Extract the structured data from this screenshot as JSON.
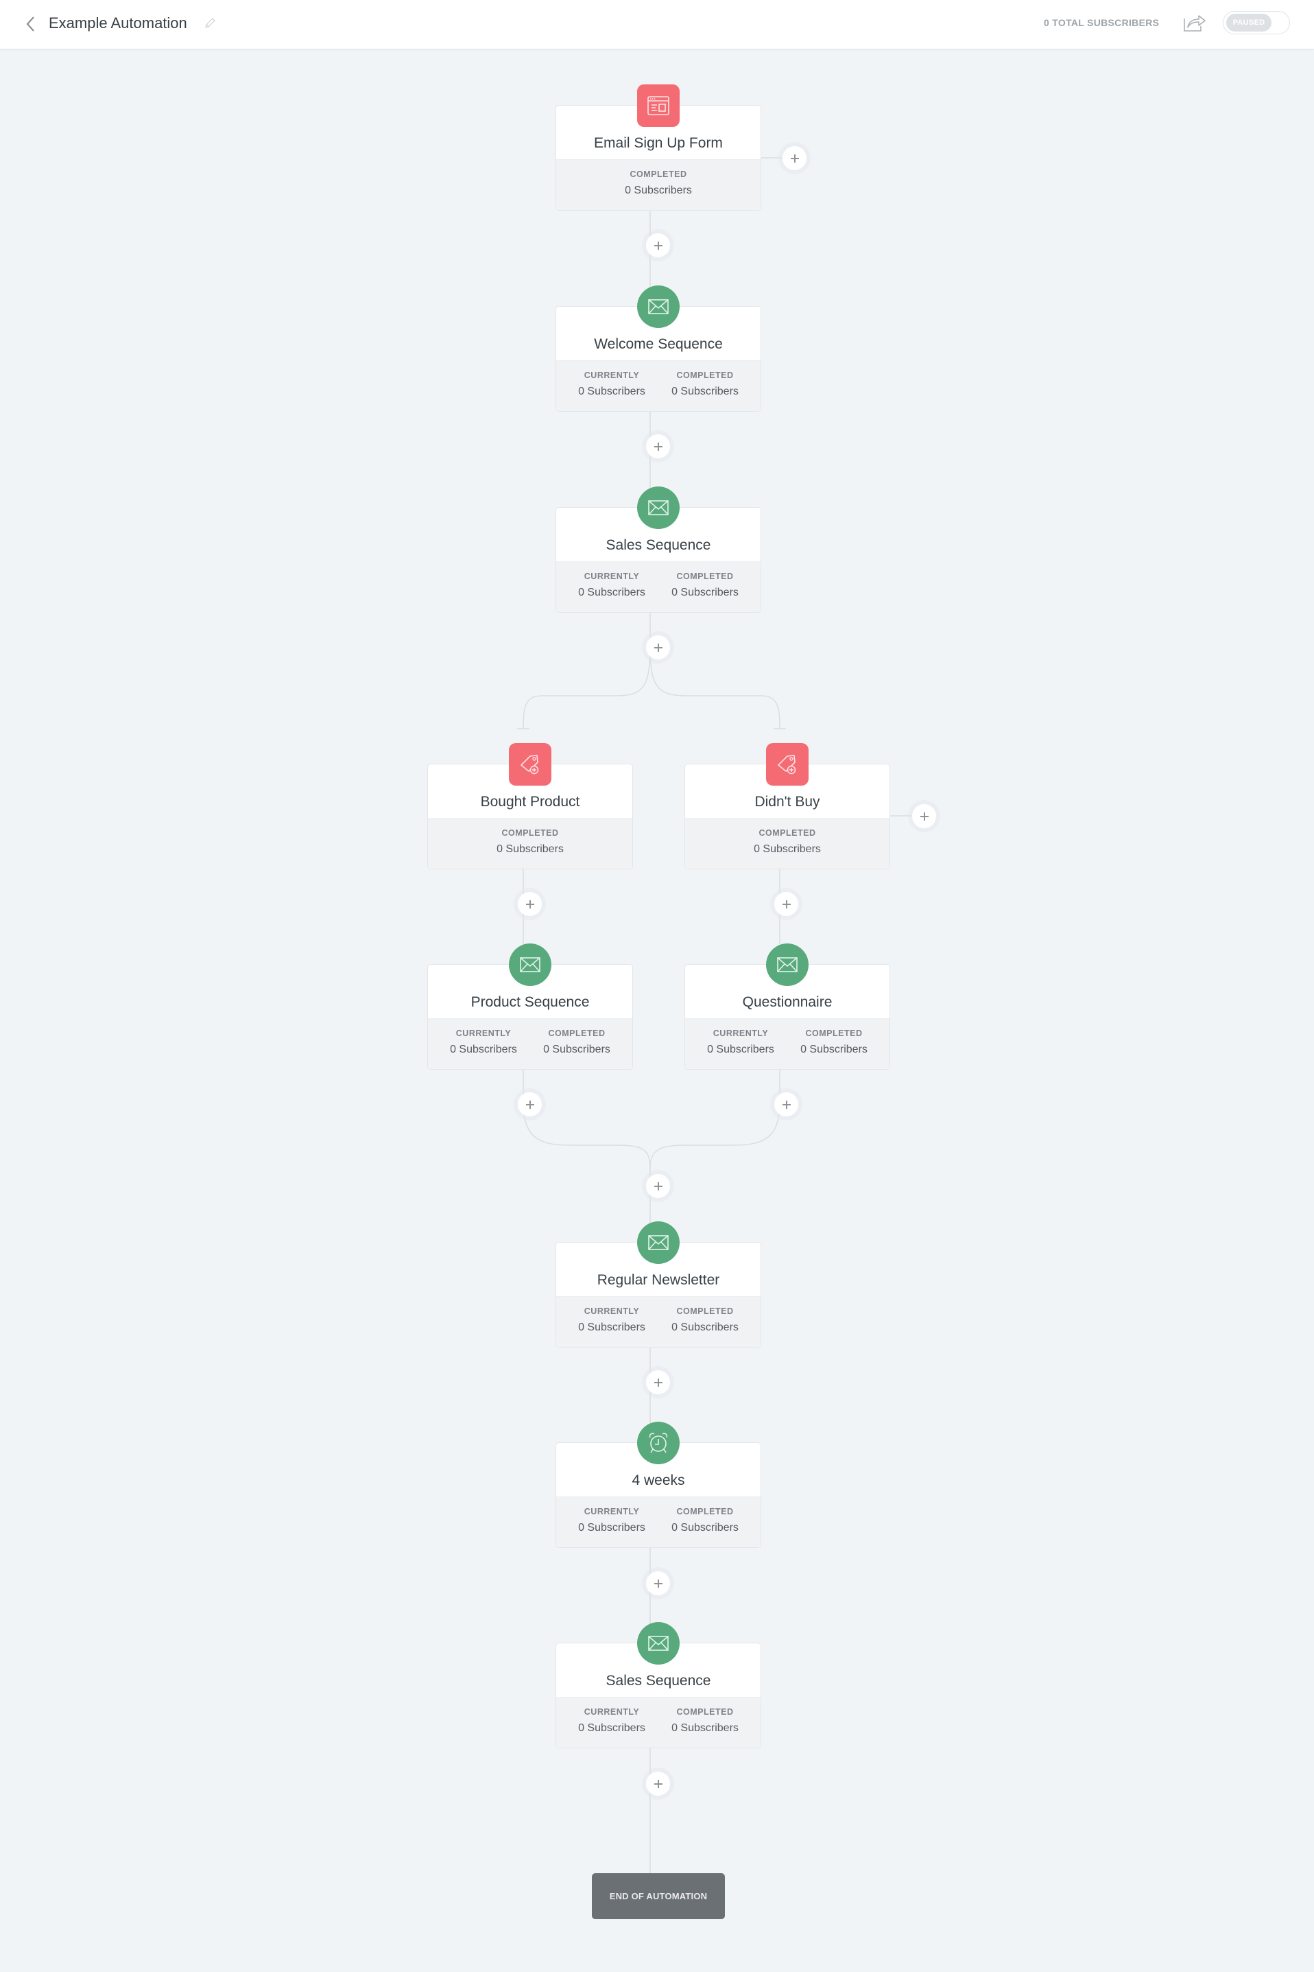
{
  "header": {
    "title": "Example Automation",
    "total_subscribers": "0 TOTAL SUBSCRIBERS",
    "status_toggle": "PAUSED",
    "icons": {
      "back": "chevron-left-icon",
      "edit": "pencil-icon",
      "share": "share-icon"
    }
  },
  "colors": {
    "trigger_accent": "#f56b73",
    "action_accent": "#58a97c",
    "background": "#f1f4f7",
    "end_box": "#6b7075"
  },
  "nodes": [
    {
      "name": "Email Sign Up Form",
      "icon": "form-icon",
      "kind": "trigger",
      "stats": [
        {
          "label": "COMPLETED",
          "value": "0 Subscribers"
        }
      ]
    },
    {
      "name": "Welcome Sequence",
      "icon": "envelope-icon",
      "kind": "sequence",
      "stats": [
        {
          "label": "CURRENTLY",
          "value": "0 Subscribers"
        },
        {
          "label": "COMPLETED",
          "value": "0 Subscribers"
        }
      ]
    },
    {
      "name": "Sales Sequence",
      "icon": "envelope-icon",
      "kind": "sequence",
      "stats": [
        {
          "label": "CURRENTLY",
          "value": "0 Subscribers"
        },
        {
          "label": "COMPLETED",
          "value": "0 Subscribers"
        }
      ]
    },
    {
      "name": "Bought Product",
      "icon": "tag-icon",
      "kind": "event",
      "stats": [
        {
          "label": "COMPLETED",
          "value": "0 Subscribers"
        }
      ]
    },
    {
      "name": "Didn't Buy",
      "icon": "tag-icon",
      "kind": "event",
      "stats": [
        {
          "label": "COMPLETED",
          "value": "0 Subscribers"
        }
      ]
    },
    {
      "name": "Product Sequence",
      "icon": "envelope-icon",
      "kind": "sequence",
      "stats": [
        {
          "label": "CURRENTLY",
          "value": "0 Subscribers"
        },
        {
          "label": "COMPLETED",
          "value": "0 Subscribers"
        }
      ]
    },
    {
      "name": "Questionnaire",
      "icon": "envelope-icon",
      "kind": "sequence",
      "stats": [
        {
          "label": "CURRENTLY",
          "value": "0 Subscribers"
        },
        {
          "label": "COMPLETED",
          "value": "0 Subscribers"
        }
      ]
    },
    {
      "name": "Regular Newsletter",
      "icon": "envelope-icon",
      "kind": "sequence",
      "stats": [
        {
          "label": "CURRENTLY",
          "value": "0 Subscribers"
        },
        {
          "label": "COMPLETED",
          "value": "0 Subscribers"
        }
      ]
    },
    {
      "name": "4 weeks",
      "icon": "alarm-clock-icon",
      "kind": "delay",
      "stats": [
        {
          "label": "CURRENTLY",
          "value": "0 Subscribers"
        },
        {
          "label": "COMPLETED",
          "value": "0 Subscribers"
        }
      ]
    },
    {
      "name": "Sales Sequence",
      "icon": "envelope-icon",
      "kind": "sequence",
      "stats": [
        {
          "label": "CURRENTLY",
          "value": "0 Subscribers"
        },
        {
          "label": "COMPLETED",
          "value": "0 Subscribers"
        }
      ]
    }
  ],
  "end_label": "END OF AUTOMATION"
}
